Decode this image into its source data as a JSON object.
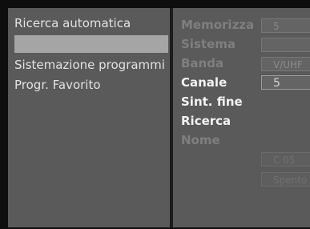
{
  "left_menu": {
    "item_1": "Ricerca automatica",
    "item_2": "",
    "item_3": "Sistemazione programmi",
    "item_4": "Progr. Favorito"
  },
  "right_menu": {
    "memorizza": {
      "label": "Memorizza",
      "value": "5"
    },
    "sistema": {
      "label": "Sistema",
      "value": ""
    },
    "banda": {
      "label": "Banda",
      "value": "V/UHF"
    },
    "canale": {
      "label": "Canale",
      "value": "5"
    },
    "sint_fine": {
      "label": "Sint.  fine"
    },
    "ricerca": {
      "label": "Ricerca"
    },
    "nome": {
      "label": "Nome"
    },
    "nome_value": "C 05",
    "faint_label": "",
    "faint_value": "Spento"
  }
}
